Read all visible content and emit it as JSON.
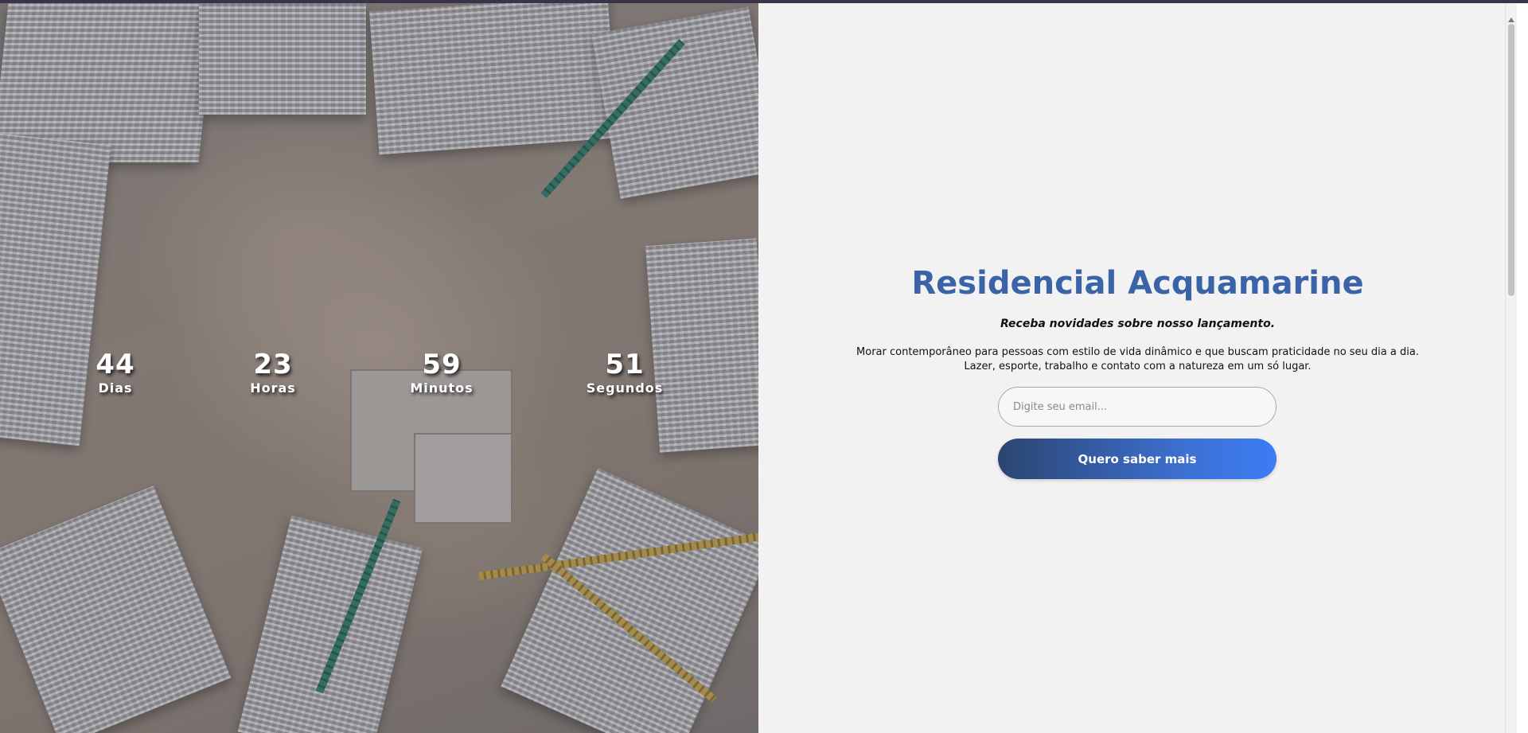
{
  "countdown": {
    "days": {
      "value": "44",
      "label": "Dias"
    },
    "hours": {
      "value": "23",
      "label": "Horas"
    },
    "minutes": {
      "value": "59",
      "label": "Minutos"
    },
    "seconds": {
      "value": "51",
      "label": "Segundos"
    }
  },
  "signup": {
    "title": "Residencial Acquamarine",
    "tagline": "Receba novidades sobre nosso lançamento.",
    "description_line1": "Morar contemporâneo para pessoas com estilo de vida dinâmico e que buscam praticidade no seu dia a dia.",
    "description_line2": "Lazer, esporte, trabalho e contato com a natureza em um só lugar.",
    "email_placeholder": "Digite seu email...",
    "email_value": "",
    "button_label": "Quero saber mais"
  },
  "colors": {
    "title": "#3a63a8",
    "button_gradient_start": "#2c4570",
    "button_gradient_end": "#3d7cf5",
    "panel_background": "#f2f2f2"
  }
}
